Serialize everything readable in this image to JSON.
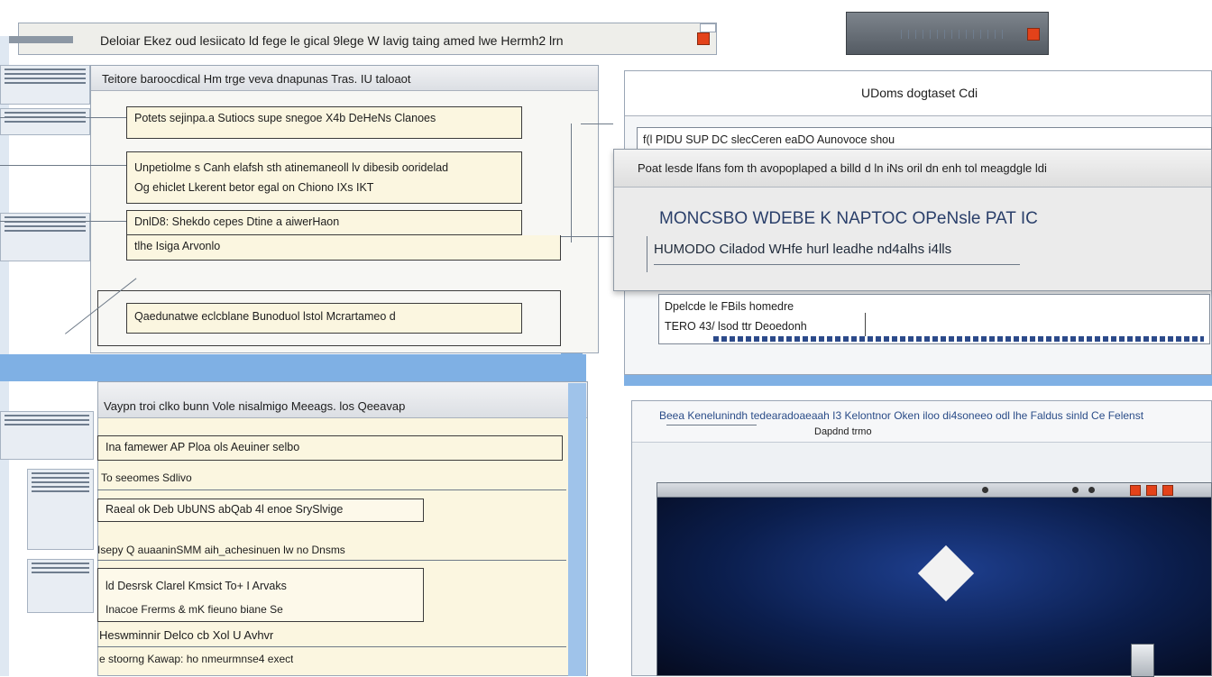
{
  "top_bar": {
    "title": "Deloiar Ekez oud lesiicato ld fege le gical 9lege W lavig taing amed lwe Hermh2 lrn"
  },
  "top_widget": {
    "label": ""
  },
  "left_window": {
    "header": "Teitore baroocdical Hm trge veva dnapunas Tras. IU taloaot",
    "field1": "Potets sejinpa.a Sutiocs supe snegoe X4b DeHeNs Clanoes",
    "field2": "Unpetiolme s Canh elafsh sth atinemaneoll lv dibesib ooridelad",
    "field2_line2": "Og ehiclet Lkerent betor egal on Chiono IXs IKT",
    "field3": "DnlD8: Shekdo cepes Dtine a aiwerHaon",
    "field3_line2": "tlhe Isiga Arvonlo",
    "field4": "Qaedunatwe eclcblane Bunoduol lstol Mcrartameo d"
  },
  "left_bottom_window": {
    "header": "Vaypn troi clko bunn Vole nisalmigo Meeags. los Qeeavap",
    "field1": "Ina famewer AP Ploa ols Aeuiner selbo",
    "line1": "To seeomes Sdlivo",
    "field2": "Raeal ok Deb UbUNS abQab 4l enoe SrySlvige",
    "line2": "Isepy Q auaaninSMM aih_achesinuen lw no Dnsms",
    "field3": "ld Desrsk  Clarel Kmsict To+ I Arvaks",
    "line3": "Inacoe Frerms & mK fieuno biane Se",
    "line4": "Heswminnir Delco cb Xol U Avhvr",
    "line5": "e stoorng Kawap: ho nmeurmnse4 exect"
  },
  "right_window": {
    "title": "UDoms dogtaset Cdi",
    "row1": "f(l PIDU SUP  DC  slecCeren eaDO Aunovoce shou",
    "overlay_header": "Poat lesde lfans fom th avopoplaped a billd d ln iNs oril dn enh tol meagdgle ldi",
    "overlay_big": "MONCSBO WDEBE K NAPTOC OPeNsle PAT IC",
    "overlay_sub": "HUMODO Ciladod WHfe hurl leadhe nd4alhs i4lls",
    "row2a": "Dpelcde le FBils homedre",
    "row2b": "TERO 43/   lsod ttr Deoedonh"
  },
  "right_bottom_window": {
    "header": "Beea Kenelunindh tedearadoaeaah  I3 Kelontnor  Oken iloo di4soneeo odl lhe Faldus sinld Ce Felenst",
    "subheader": "Dapdnd trmo",
    "viewport": {
      "icon": "diamond-icon"
    }
  },
  "colors": {
    "accent": "#7fb0e4",
    "field_bg": "#fbf6e0",
    "viewport_bg": "#0b1e4d"
  }
}
